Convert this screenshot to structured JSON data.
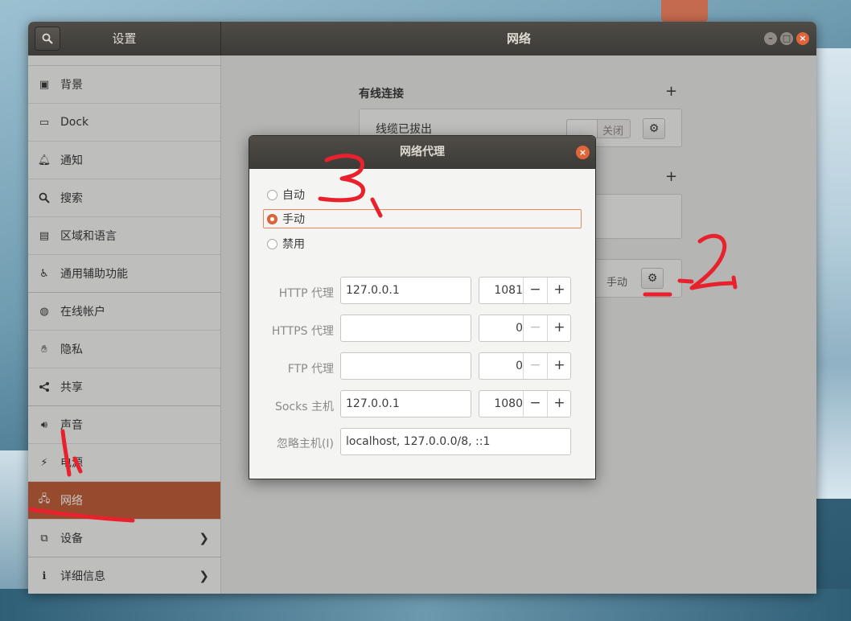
{
  "settings_window": {
    "left_title": "设置",
    "center_title": "网络",
    "sidebar": [
      {
        "label": "背景",
        "icon": "background-icon"
      },
      {
        "label": "Dock",
        "icon": "dock-icon"
      },
      {
        "label": "通知",
        "icon": "bell-icon"
      },
      {
        "label": "搜索",
        "icon": "search-icon"
      },
      {
        "label": "区域和语言",
        "icon": "region-icon"
      },
      {
        "label": "通用辅助功能",
        "icon": "accessibility-icon"
      },
      {
        "label": "在线帐户",
        "icon": "online-accounts-icon"
      },
      {
        "label": "隐私",
        "icon": "privacy-hand-icon"
      },
      {
        "label": "共享",
        "icon": "share-icon"
      },
      {
        "label": "声音",
        "icon": "speaker-icon"
      },
      {
        "label": "电源",
        "icon": "power-icon"
      },
      {
        "label": "网络",
        "icon": "network-icon",
        "active": true
      },
      {
        "label": "设备",
        "icon": "devices-icon",
        "has_chevron": true
      },
      {
        "label": "详细信息",
        "icon": "info-icon",
        "has_chevron": true
      }
    ]
  },
  "network_page": {
    "wired_title": "有线连接",
    "wired_status": "线缆已拔出",
    "wired_switch_label": "关闭",
    "proxy_status": "手动"
  },
  "proxy_dialog": {
    "title": "网络代理",
    "options": [
      "自动",
      "手动",
      "禁用"
    ],
    "selected": "手动",
    "fields": {
      "http_label": "HTTP 代理",
      "http_host": "127.0.0.1",
      "http_port": "1081",
      "https_label": "HTTPS 代理",
      "https_host": "",
      "https_port": "0",
      "ftp_label": "FTP 代理",
      "ftp_host": "",
      "ftp_port": "0",
      "socks_label": "Socks 主机",
      "socks_host": "127.0.0.1",
      "socks_port": "1080",
      "ignore_label": "忽略主机(I)",
      "ignore_hosts": "localhost, 127.0.0.0/8, ::1"
    }
  },
  "annotations": {
    "step1": "1.",
    "step2": "2.",
    "step3": "3."
  },
  "colors": {
    "accent": "#c0603d",
    "annotation_red": "#e8212c",
    "titlebar": "#45423d"
  }
}
